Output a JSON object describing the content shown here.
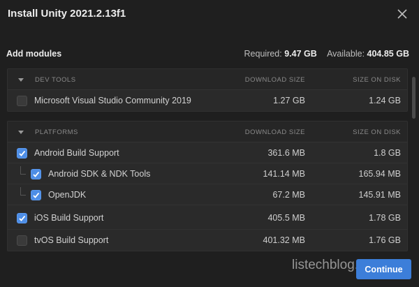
{
  "window": {
    "title": "Install Unity 2021.2.13f1"
  },
  "summary": {
    "heading": "Add modules",
    "required_label": "Required:",
    "required_value": "9.47 GB",
    "available_label": "Available:",
    "available_value": "404.85 GB"
  },
  "columns": {
    "download": "DOWNLOAD SIZE",
    "disk": "SIZE ON DISK"
  },
  "sections": [
    {
      "title": "DEV TOOLS",
      "rows": [
        {
          "label": "Microsoft Visual Studio Community 2019",
          "download": "1.27 GB",
          "disk": "1.24 GB",
          "checked": false,
          "child": false
        }
      ]
    },
    {
      "title": "PLATFORMS",
      "rows": [
        {
          "label": "Android Build Support",
          "download": "361.6 MB",
          "disk": "1.8 GB",
          "checked": true,
          "child": false
        },
        {
          "label": "Android SDK & NDK Tools",
          "download": "141.14 MB",
          "disk": "165.94 MB",
          "checked": true,
          "child": true
        },
        {
          "label": "OpenJDK",
          "download": "67.2 MB",
          "disk": "145.91 MB",
          "checked": true,
          "child": true
        },
        {
          "label": "iOS Build Support",
          "download": "405.5 MB",
          "disk": "1.78 GB",
          "checked": true,
          "child": false
        },
        {
          "label": "tvOS Build Support",
          "download": "401.32 MB",
          "disk": "1.76 GB",
          "checked": false,
          "child": false
        }
      ]
    }
  ],
  "footer": {
    "watermark": "listechblog.com",
    "continue_label": "Continue"
  },
  "colors": {
    "accent": "#3c7ed9",
    "background": "#1f1f1f",
    "panel": "#2a2a2a"
  },
  "icons": {
    "close": "close-icon",
    "caret": "caret-down-icon",
    "check": "checkmark-icon"
  }
}
